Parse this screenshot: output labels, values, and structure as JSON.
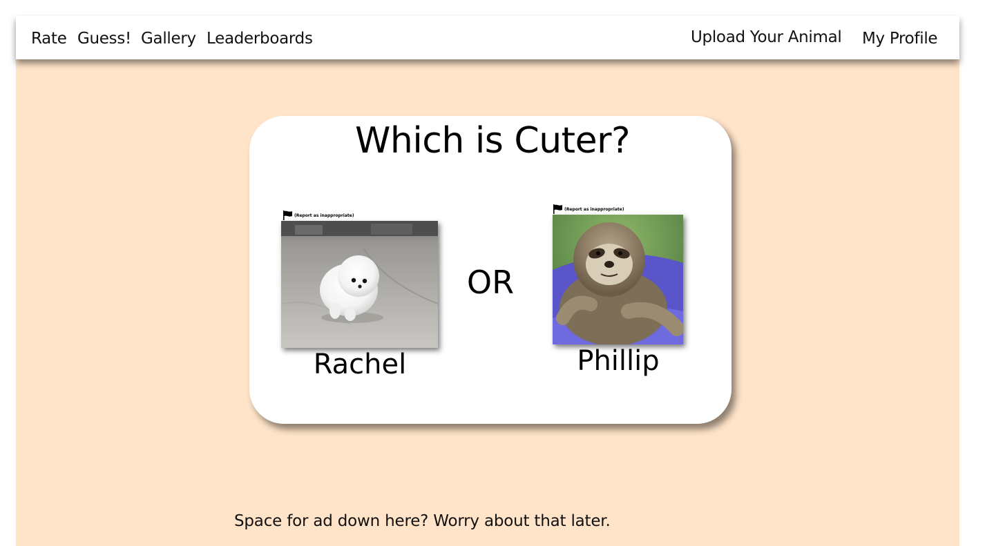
{
  "nav": {
    "left": [
      "Rate",
      "Guess!",
      "Gallery",
      "Leaderboards"
    ],
    "right": [
      "Upload Your Animal",
      "My Profile"
    ]
  },
  "card": {
    "title": "Which is Cuter?",
    "separator": "OR",
    "left": {
      "name": "Rachel",
      "report": "(Report as inappropriate)"
    },
    "right": {
      "name": "Phillip",
      "report": "(Report as inappropriate)"
    }
  },
  "footer": {
    "text": "Space for ad down here? Worry about that later."
  },
  "colors": {
    "background": "#ffe4c9",
    "card": "#ffffff",
    "nav": "#ffffff"
  }
}
